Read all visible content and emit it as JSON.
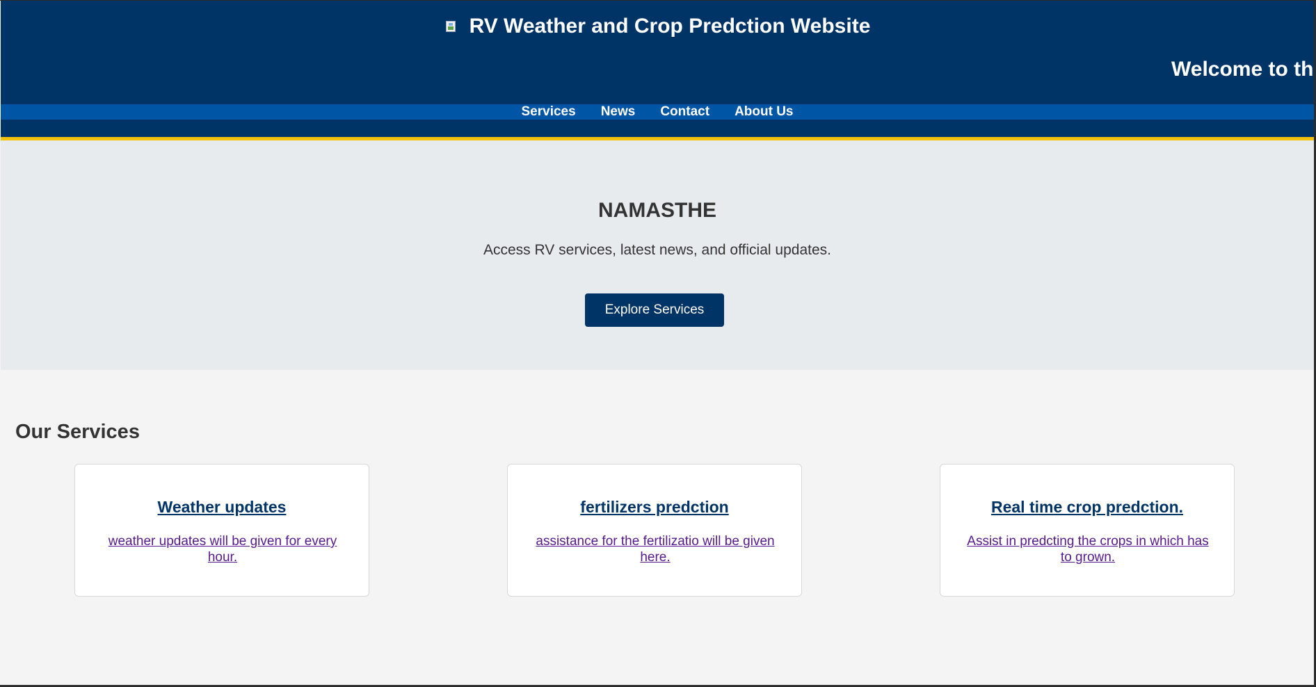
{
  "header": {
    "logo_icon": "broken-image-icon",
    "title": "RV Weather and Crop Predction Website",
    "marquee": "Welcome to th"
  },
  "nav": {
    "items": [
      "Services",
      "News",
      "Contact",
      "About Us"
    ]
  },
  "hero": {
    "title": "NAMASTHE",
    "subtitle": "Access RV services, latest news, and official updates.",
    "button_label": "Explore Services"
  },
  "services": {
    "heading": "Our Services",
    "cards": [
      {
        "title": "Weather updates",
        "description": "weather updates will be given for every hour."
      },
      {
        "title": "fertilizers predction",
        "description": "assistance for the fertilizatio will be given here."
      },
      {
        "title": "Real time crop predction.",
        "description": "Assist in predcting the crops in which has to grown."
      }
    ]
  },
  "colors": {
    "header_bg": "#003366",
    "nav_bg": "#0055a5",
    "accent_line": "#f4c20d",
    "hero_bg": "#e8ebee",
    "page_bg": "#f4f4f4",
    "visited_link": "#551a8b"
  }
}
